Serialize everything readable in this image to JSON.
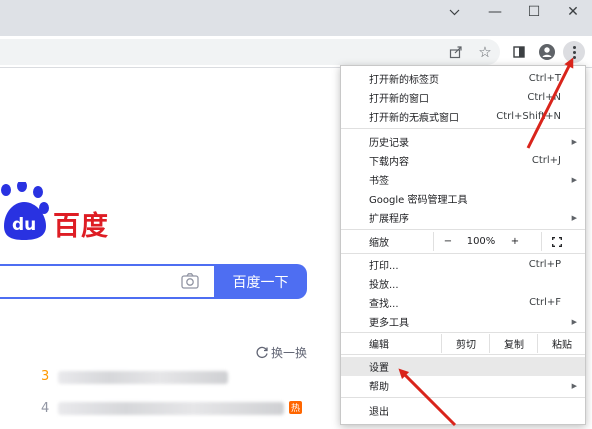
{
  "window_controls": {
    "tab_list_icon": "chevron-down-icon",
    "minimize_glyph": "—",
    "maximize_glyph": "☐",
    "close_glyph": "✕"
  },
  "toolbar": {
    "share_icon": "share-icon",
    "bookmark_glyph": "☆",
    "side_panel_icon": "side-panel-icon",
    "profile_icon": "profile-icon",
    "menu_icon": "three-dots-vertical-icon"
  },
  "page": {
    "logo_text": "百度",
    "search_placeholder": "",
    "search_button": "百度一下",
    "refresh_label": "换一换",
    "hot_items": [
      {
        "rank": "3",
        "color": "#ff9900"
      },
      {
        "rank": "4",
        "color": "#9195a3",
        "badge": "热"
      }
    ]
  },
  "menu": {
    "items": [
      {
        "label": "打开新的标签页",
        "shortcut": "Ctrl+T"
      },
      {
        "label": "打开新的窗口",
        "shortcut": "Ctrl+N"
      },
      {
        "label": "打开新的无痕式窗口",
        "shortcut": "Ctrl+Shift+N"
      },
      {
        "label": "历史记录",
        "submenu": true
      },
      {
        "label": "下载内容",
        "shortcut": "Ctrl+J"
      },
      {
        "label": "书签",
        "submenu": true
      },
      {
        "label": "Google 密码管理工具"
      },
      {
        "label": "扩展程序",
        "submenu": true
      },
      {
        "label": "缩放"
      },
      {
        "label": "打印...",
        "shortcut": "Ctrl+P"
      },
      {
        "label": "投放..."
      },
      {
        "label": "查找...",
        "shortcut": "Ctrl+F"
      },
      {
        "label": "更多工具",
        "submenu": true
      },
      {
        "label": "编辑"
      },
      {
        "label": "设置"
      },
      {
        "label": "帮助",
        "submenu": true
      },
      {
        "label": "退出"
      }
    ],
    "zoom": {
      "minus": "−",
      "value": "100%",
      "plus": "+",
      "fullscreen_icon": "fullscreen-icon"
    },
    "edit": {
      "cut": "剪切",
      "copy": "复制",
      "paste": "粘贴"
    },
    "highlighted": "设置"
  },
  "colors": {
    "accent": "#4e6ef2",
    "logo_red": "#de1d24",
    "logo_blue": "#2932e1",
    "annotation_arrow": "#d9241b"
  }
}
